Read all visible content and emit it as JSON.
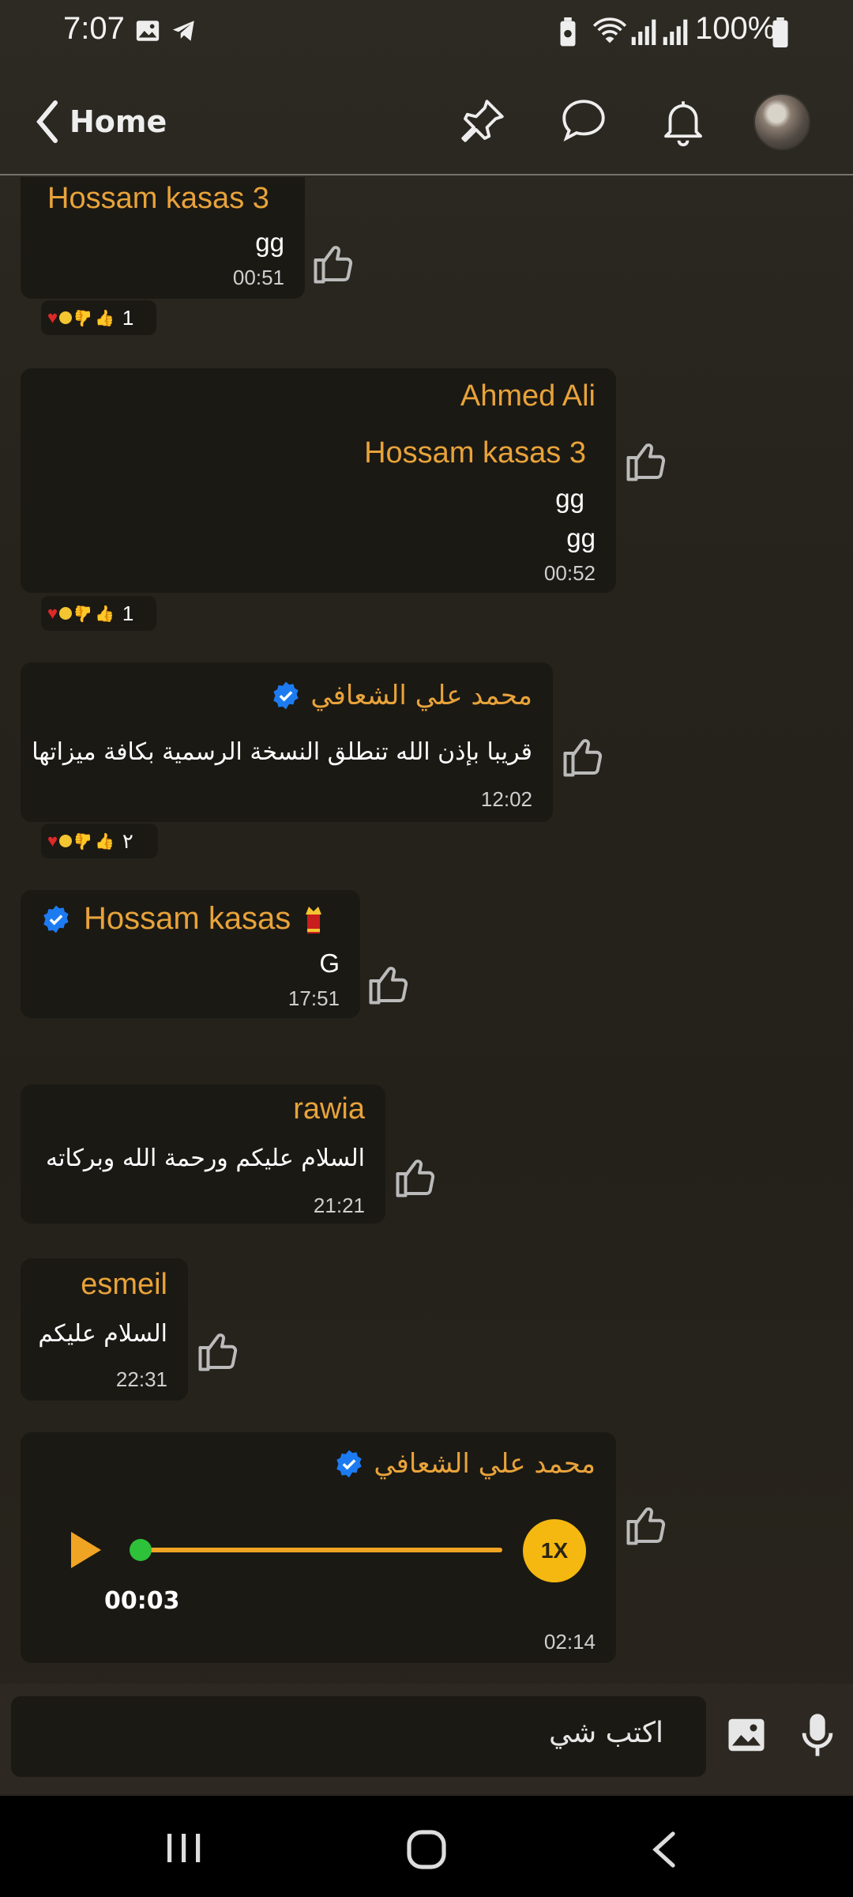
{
  "status_bar": {
    "time": "7:07",
    "battery": "100%"
  },
  "header": {
    "back_label": "Home",
    "icons": [
      "pin-icon",
      "chat-icon",
      "bell-icon"
    ]
  },
  "messages": [
    {
      "sender": "Hossam kasas 3",
      "text": "gg",
      "time": "00:51",
      "reaction_count": "1"
    },
    {
      "sender": "Ahmed Ali",
      "quoted_sender": "Hossam kasas 3",
      "quoted_text": "gg",
      "text": "gg",
      "time": "00:52",
      "reaction_count": "1"
    },
    {
      "sender": "محمد علي الشعافي",
      "text": "قريبا بإذن الله تنطلق النسخة الرسمية بكافة ميزاتها",
      "time": "12:02",
      "reaction_count": "٢"
    },
    {
      "sender": "Hossam kasas",
      "text": "G",
      "time": "17:51"
    },
    {
      "sender": "rawia",
      "text": "السلام عليكم ورحمة الله وبركاته",
      "time": "21:21"
    },
    {
      "sender": "esmeil",
      "text": "السلام عليكم",
      "time": "22:31"
    },
    {
      "sender": "محمد علي الشعافي",
      "voice_elapsed": "00:03",
      "voice_speed": "1X",
      "time": "02:14",
      "voice_progress": 0.0
    }
  ],
  "composer": {
    "placeholder": "اكتب شي"
  },
  "colors": {
    "accent": "#e8a33a",
    "verified": "#1d7bf2",
    "bubble": "#1b1914"
  }
}
